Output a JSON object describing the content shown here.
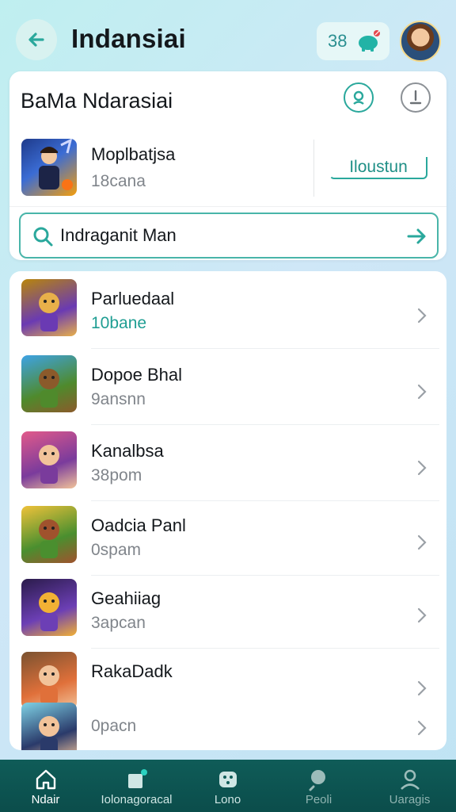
{
  "header": {
    "title": "Indansiai",
    "coin_count": "38"
  },
  "featured": {
    "title": "BaMa Ndarasiai",
    "app_name": "Moplbatjsa",
    "app_sub": "18cana",
    "install_label": "Iloustun",
    "search_value": "Indraganit Man"
  },
  "list": [
    {
      "name": "Parluedaal",
      "sub": "10bane",
      "accent": true,
      "thumb_colors": [
        "#b8860b",
        "#6a3ab3",
        "#e8b04a"
      ]
    },
    {
      "name": "Dopoe Bhal",
      "sub": "9ansnn",
      "accent": false,
      "thumb_colors": [
        "#3ea3e6",
        "#4f8a2c",
        "#8b5a2b"
      ]
    },
    {
      "name": "Kanalbsa",
      "sub": "38pom",
      "accent": false,
      "thumb_colors": [
        "#e25a8a",
        "#7a3b9c",
        "#f2c39a"
      ]
    },
    {
      "name": "Oadcia Panl",
      "sub": "0spam",
      "accent": false,
      "thumb_colors": [
        "#f0c23a",
        "#4a8f2f",
        "#a0522d"
      ]
    },
    {
      "name": "Geahiiag",
      "sub": "3apcan",
      "accent": false,
      "thumb_colors": [
        "#2a1b4a",
        "#6c3fb5",
        "#f2b134"
      ]
    },
    {
      "name": "RakaDadk",
      "sub": "",
      "accent": false,
      "thumb_colors": [
        "#7a5230",
        "#e0703a",
        "#f2c39a"
      ]
    },
    {
      "name": "",
      "sub": "0pacn",
      "accent": false,
      "thumb_colors": [
        "#7fd3e6",
        "#2a3a6a",
        "#f2c39a"
      ]
    }
  ],
  "nav": [
    {
      "label": "Ndair",
      "icon": "home-icon",
      "active": true
    },
    {
      "label": "Iolonagoracal",
      "icon": "games-icon",
      "active": false
    },
    {
      "label": "Lono",
      "icon": "controller-icon",
      "active": false
    },
    {
      "label": "Peoli",
      "icon": "search-icon",
      "active": false
    },
    {
      "label": "Uaragis",
      "icon": "profile-icon",
      "active": false
    }
  ],
  "colors": {
    "accent": "#2aa89c",
    "nav_bg": "#0f5c58"
  }
}
